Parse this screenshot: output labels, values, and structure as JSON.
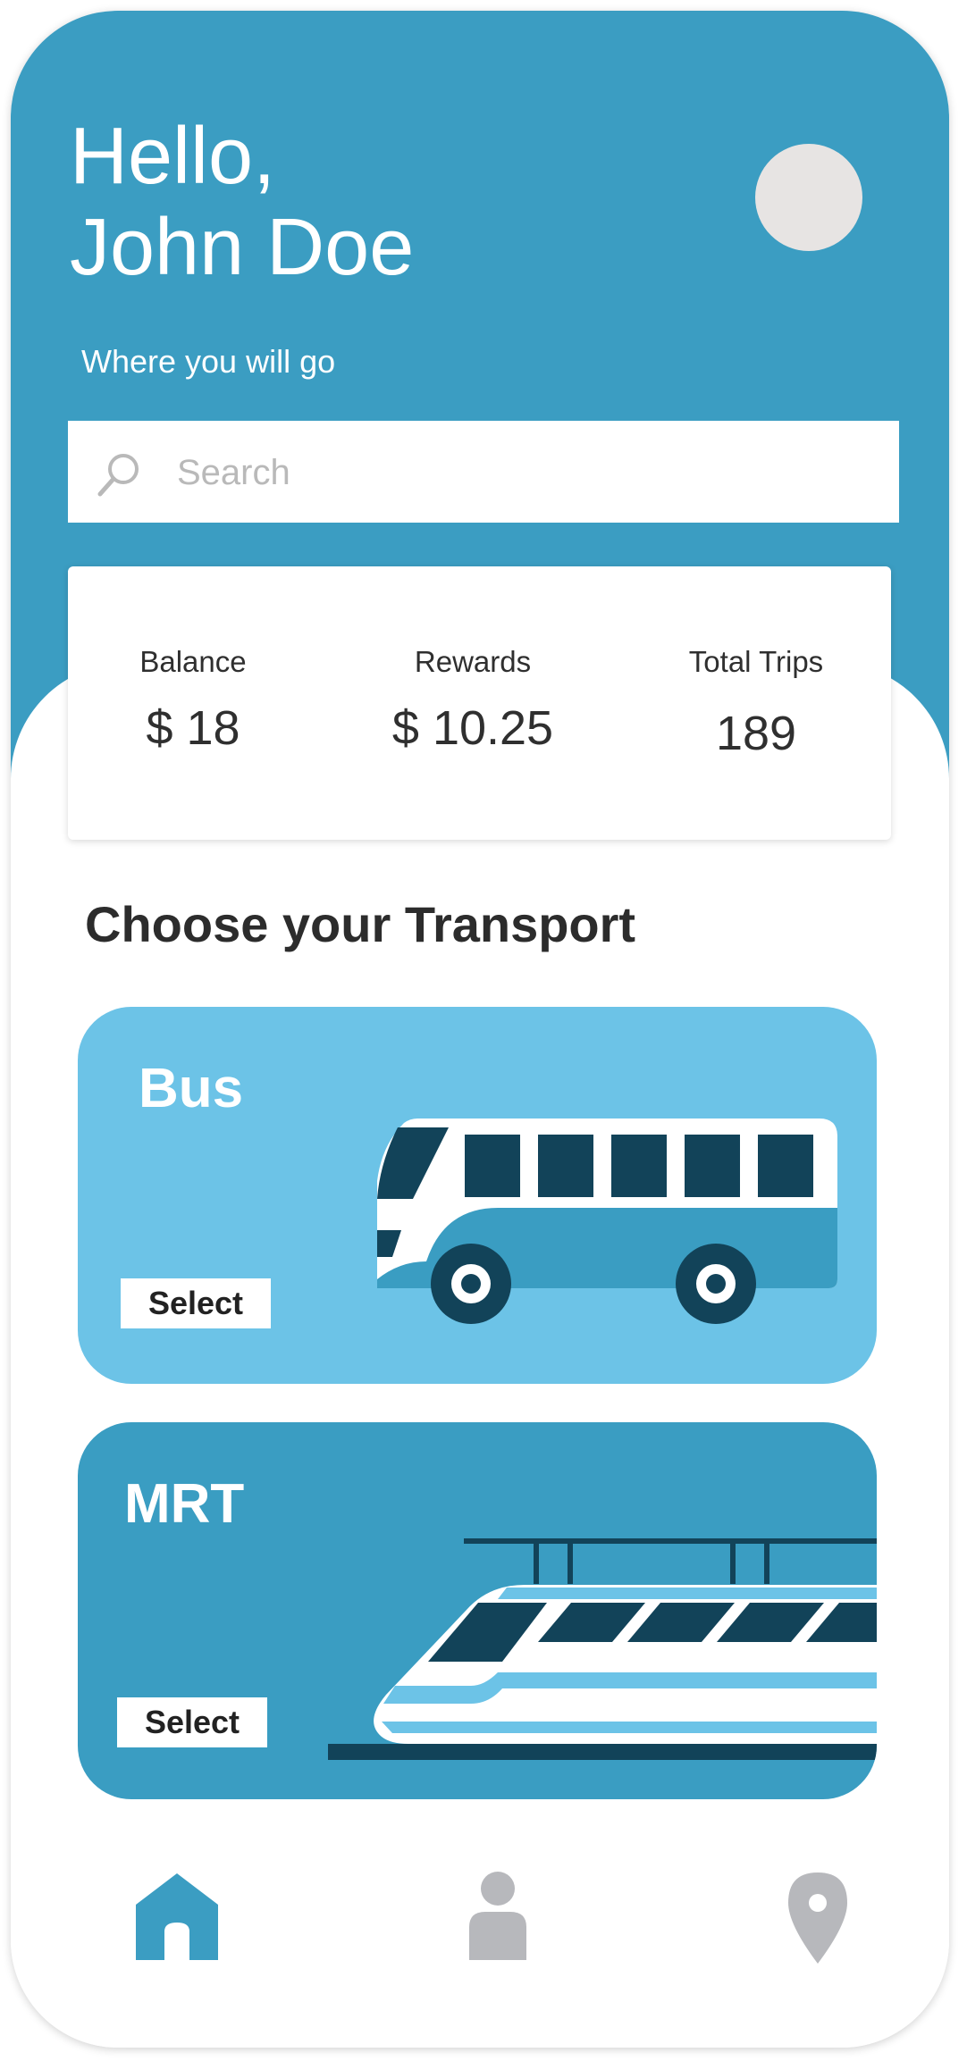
{
  "header": {
    "greeting_line1": "Hello,",
    "greeting_line2": "John Doe",
    "subtitle": "Where you will go"
  },
  "search": {
    "placeholder": "Search",
    "icon": "search-icon"
  },
  "stats": [
    {
      "label": "Balance",
      "value": "$ 18"
    },
    {
      "label": "Rewards",
      "value": "$ 10.25"
    },
    {
      "label": "Total Trips",
      "value": "189"
    }
  ],
  "section_title": "Choose your Transport",
  "transport": [
    {
      "name": "Bus",
      "select_label": "Select",
      "icon": "bus-illustration"
    },
    {
      "name": "MRT",
      "select_label": "Select",
      "icon": "train-illustration"
    }
  ],
  "nav": [
    {
      "name": "home",
      "icon": "home-icon",
      "active": true
    },
    {
      "name": "profile",
      "icon": "user-icon",
      "active": false
    },
    {
      "name": "location",
      "icon": "location-pin-icon",
      "active": false
    }
  ],
  "colors": {
    "primary": "#3b9dc2",
    "light_blue": "#6cc3e7",
    "dark_navy": "#124359",
    "inactive": "#b7b8bc"
  }
}
